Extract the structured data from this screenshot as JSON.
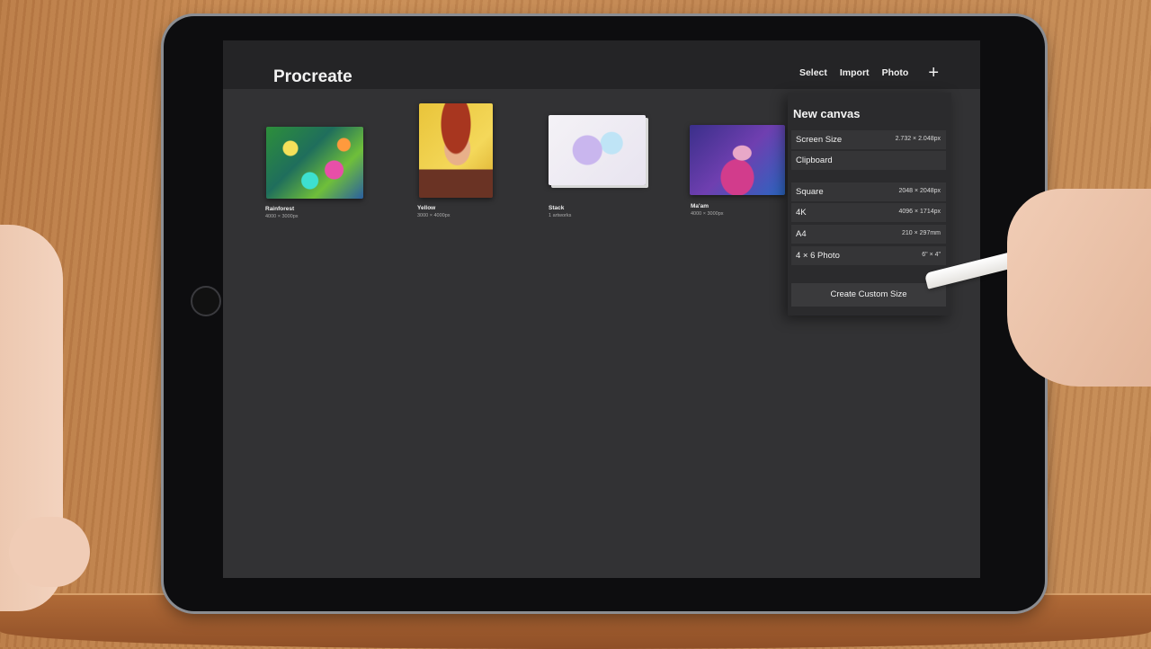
{
  "app": {
    "title": "Procreate"
  },
  "toolbar": {
    "select": "Select",
    "import": "Import",
    "photo": "Photo",
    "add_icon": "plus-icon"
  },
  "gallery": [
    {
      "name": "Rainforest",
      "size": "4000 × 3000px"
    },
    {
      "name": "Yellow",
      "size": "3000 × 4000px"
    },
    {
      "name": "Stack",
      "size": "1 artworks"
    },
    {
      "name": "Ma'am",
      "size": "4000 × 3000px"
    }
  ],
  "new_canvas": {
    "title": "New canvas",
    "rows": [
      {
        "label": "Screen Size",
        "value": "2.732 × 2.048px"
      },
      {
        "label": "Clipboard",
        "value": ""
      },
      {
        "label": "Square",
        "value": "2048 × 2048px"
      },
      {
        "label": "4K",
        "value": "4096 × 1714px"
      },
      {
        "label": "A4",
        "value": "210 × 297mm"
      },
      {
        "label": "4 × 6 Photo",
        "value": "6\" × 4\""
      }
    ],
    "create_label": "Create Custom Size"
  }
}
